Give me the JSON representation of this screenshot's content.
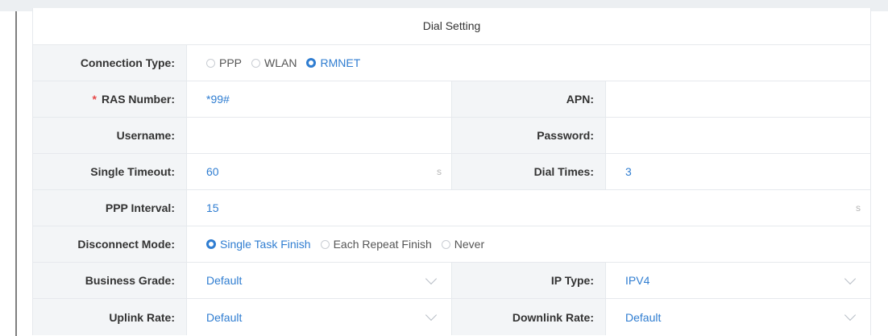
{
  "title": "Dial Setting",
  "connection_type": {
    "label": "Connection Type:",
    "options": [
      "PPP",
      "WLAN",
      "RMNET"
    ],
    "selected": "RMNET"
  },
  "ras_number": {
    "required_mark": "*",
    "label": "RAS Number:",
    "value": "*99#"
  },
  "apn": {
    "label": "APN:",
    "value": ""
  },
  "username": {
    "label": "Username:",
    "value": ""
  },
  "password": {
    "label": "Password:",
    "value": ""
  },
  "single_timeout": {
    "label": "Single Timeout:",
    "value": "60",
    "unit": "s"
  },
  "dial_times": {
    "label": "Dial Times:",
    "value": "3"
  },
  "ppp_interval": {
    "label": "PPP Interval:",
    "value": "15",
    "unit": "s"
  },
  "disconnect_mode": {
    "label": "Disconnect Mode:",
    "options": [
      "Single Task Finish",
      "Each Repeat Finish",
      "Never"
    ],
    "selected": "Single Task Finish"
  },
  "business_grade": {
    "label": "Business Grade:",
    "value": "Default",
    "icon": "chevron-down-icon"
  },
  "ip_type": {
    "label": "IP Type:",
    "value": "IPV4",
    "icon": "chevron-down-icon"
  },
  "uplink_rate": {
    "label": "Uplink Rate:",
    "value": "Default",
    "icon": "chevron-down-icon"
  },
  "downlink_rate": {
    "label": "Downlink Rate:",
    "value": "Default",
    "icon": "chevron-down-icon"
  },
  "colors": {
    "accent": "#2f7dd1",
    "label_bg": "#f3f5f7",
    "border": "#e6e9ed",
    "required": "#e64a4a"
  }
}
